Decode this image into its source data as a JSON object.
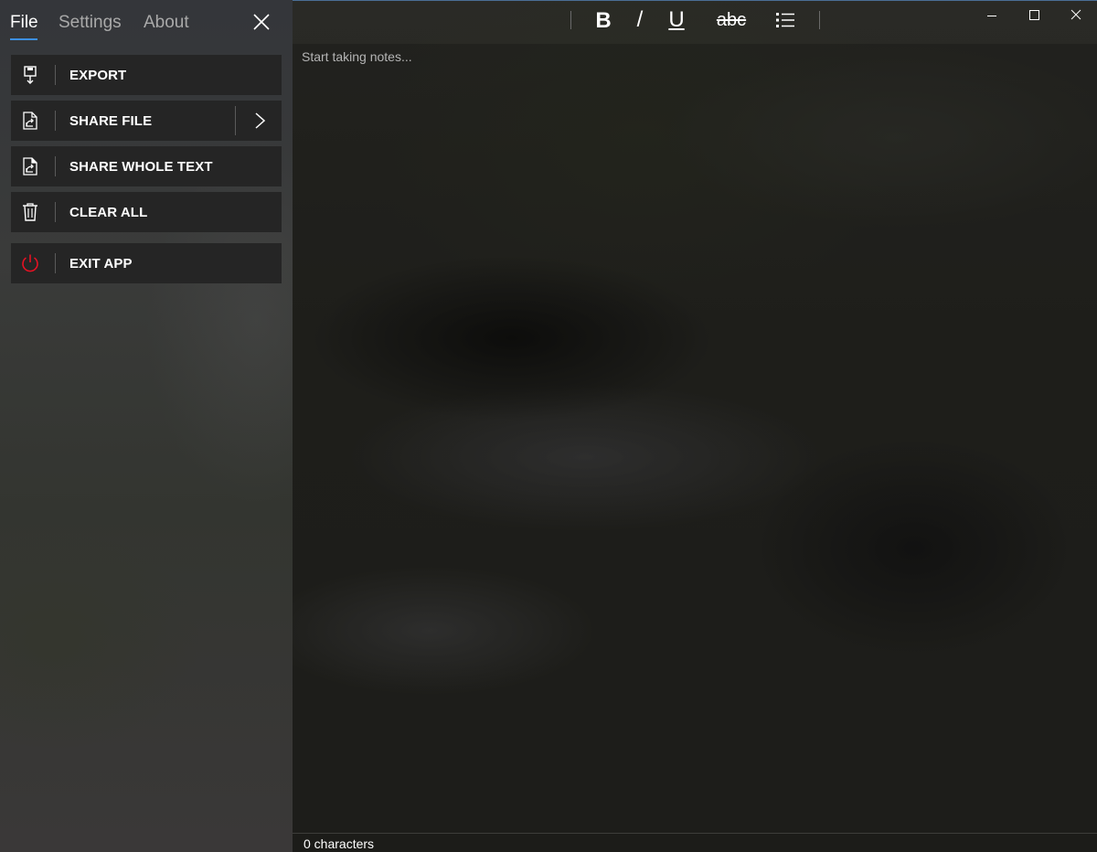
{
  "sidebar": {
    "tabs": [
      {
        "label": "File",
        "active": true
      },
      {
        "label": "Settings",
        "active": false
      },
      {
        "label": "About",
        "active": false
      }
    ],
    "close_icon": "close-icon",
    "menu": [
      {
        "label": "EXPORT",
        "icon": "save-export-icon"
      },
      {
        "label": "SHARE FILE",
        "icon": "share-file-icon",
        "has_submenu": true
      },
      {
        "label": "SHARE WHOLE TEXT",
        "icon": "share-text-icon"
      },
      {
        "label": "CLEAR ALL",
        "icon": "trash-icon"
      },
      {
        "label": "EXIT APP",
        "icon": "power-icon",
        "icon_color": "#e81123"
      }
    ]
  },
  "toolbar": {
    "bold": "B",
    "italic": "/",
    "underline": "U",
    "strikethrough": "abc",
    "list_icon": "bullet-list-icon"
  },
  "window_controls": [
    "minimize-icon",
    "maximize-icon",
    "close-icon"
  ],
  "editor": {
    "placeholder": "Start taking notes..."
  },
  "status": {
    "characters": "0 characters"
  },
  "colors": {
    "accent": "#3d8fe0",
    "menu_bg": "#252525",
    "exit_icon": "#e81123"
  }
}
